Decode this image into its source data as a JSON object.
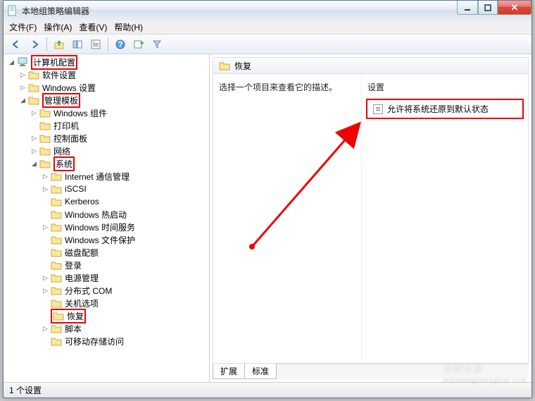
{
  "window": {
    "title": "本地组策略编辑器"
  },
  "menu": {
    "file": "文件(F)",
    "action": "操作(A)",
    "view": "查看(V)",
    "help": "帮助(H)"
  },
  "tree": {
    "root": "计算机配置",
    "software_settings": "软件设置",
    "windows_settings": "Windows 设置",
    "admin_templates": "管理模板",
    "windows_components": "Windows 组件",
    "printers": "打印机",
    "control_panel": "控制面板",
    "network": "网络",
    "system": "系统",
    "internet_comm": "Internet 通信管理",
    "iscsi": "iSCSI",
    "kerberos": "Kerberos",
    "windows_hot_start": "Windows 热启动",
    "windows_time_service": "Windows 时间服务",
    "windows_file_protection": "Windows 文件保护",
    "disk_quotas": "磁盘配额",
    "logon": "登录",
    "power_management": "电源管理",
    "distributed_com": "分布式 COM",
    "shutdown_options": "关机选项",
    "recovery": "恢复",
    "scripts": "脚本",
    "removable_storage": "可移动存储访问"
  },
  "right": {
    "header": "恢复",
    "description": "选择一个项目来查看它的描述。",
    "settings_label": "设置",
    "setting_item": "允许将系统还原到默认状态"
  },
  "tabs": {
    "extended": "扩展",
    "standard": "标准"
  },
  "status": {
    "text": "1 个设置"
  },
  "watermark": {
    "main": "秒懂生活",
    "sub": "miaodongshenghuo.com"
  }
}
